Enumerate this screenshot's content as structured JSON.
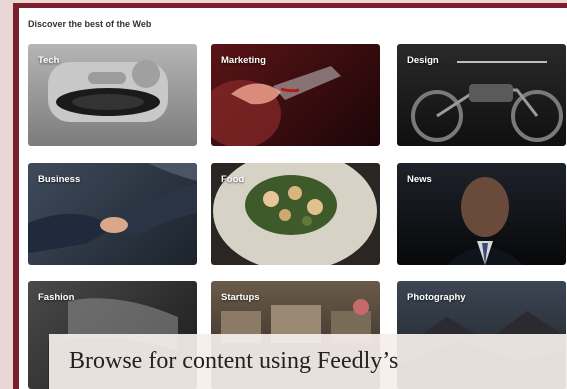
{
  "discover": {
    "heading": "Discover the best of the Web",
    "tiles": [
      {
        "label": "Tech",
        "color": "#9a9a9a"
      },
      {
        "label": "Marketing",
        "color": "#3a1012"
      },
      {
        "label": "Design",
        "color": "#1e1e1e"
      },
      {
        "label": "Business",
        "color": "#2f3a4a"
      },
      {
        "label": "Food",
        "color": "#2a2624"
      },
      {
        "label": "News",
        "color": "#15171c"
      },
      {
        "label": "Fashion",
        "color": "#2b2b2b"
      },
      {
        "label": "Startups",
        "color": "#4a3c30"
      },
      {
        "label": "Photography",
        "color": "#353c46"
      }
    ]
  },
  "caption": {
    "text": "Browse for content using Feedly’s"
  }
}
